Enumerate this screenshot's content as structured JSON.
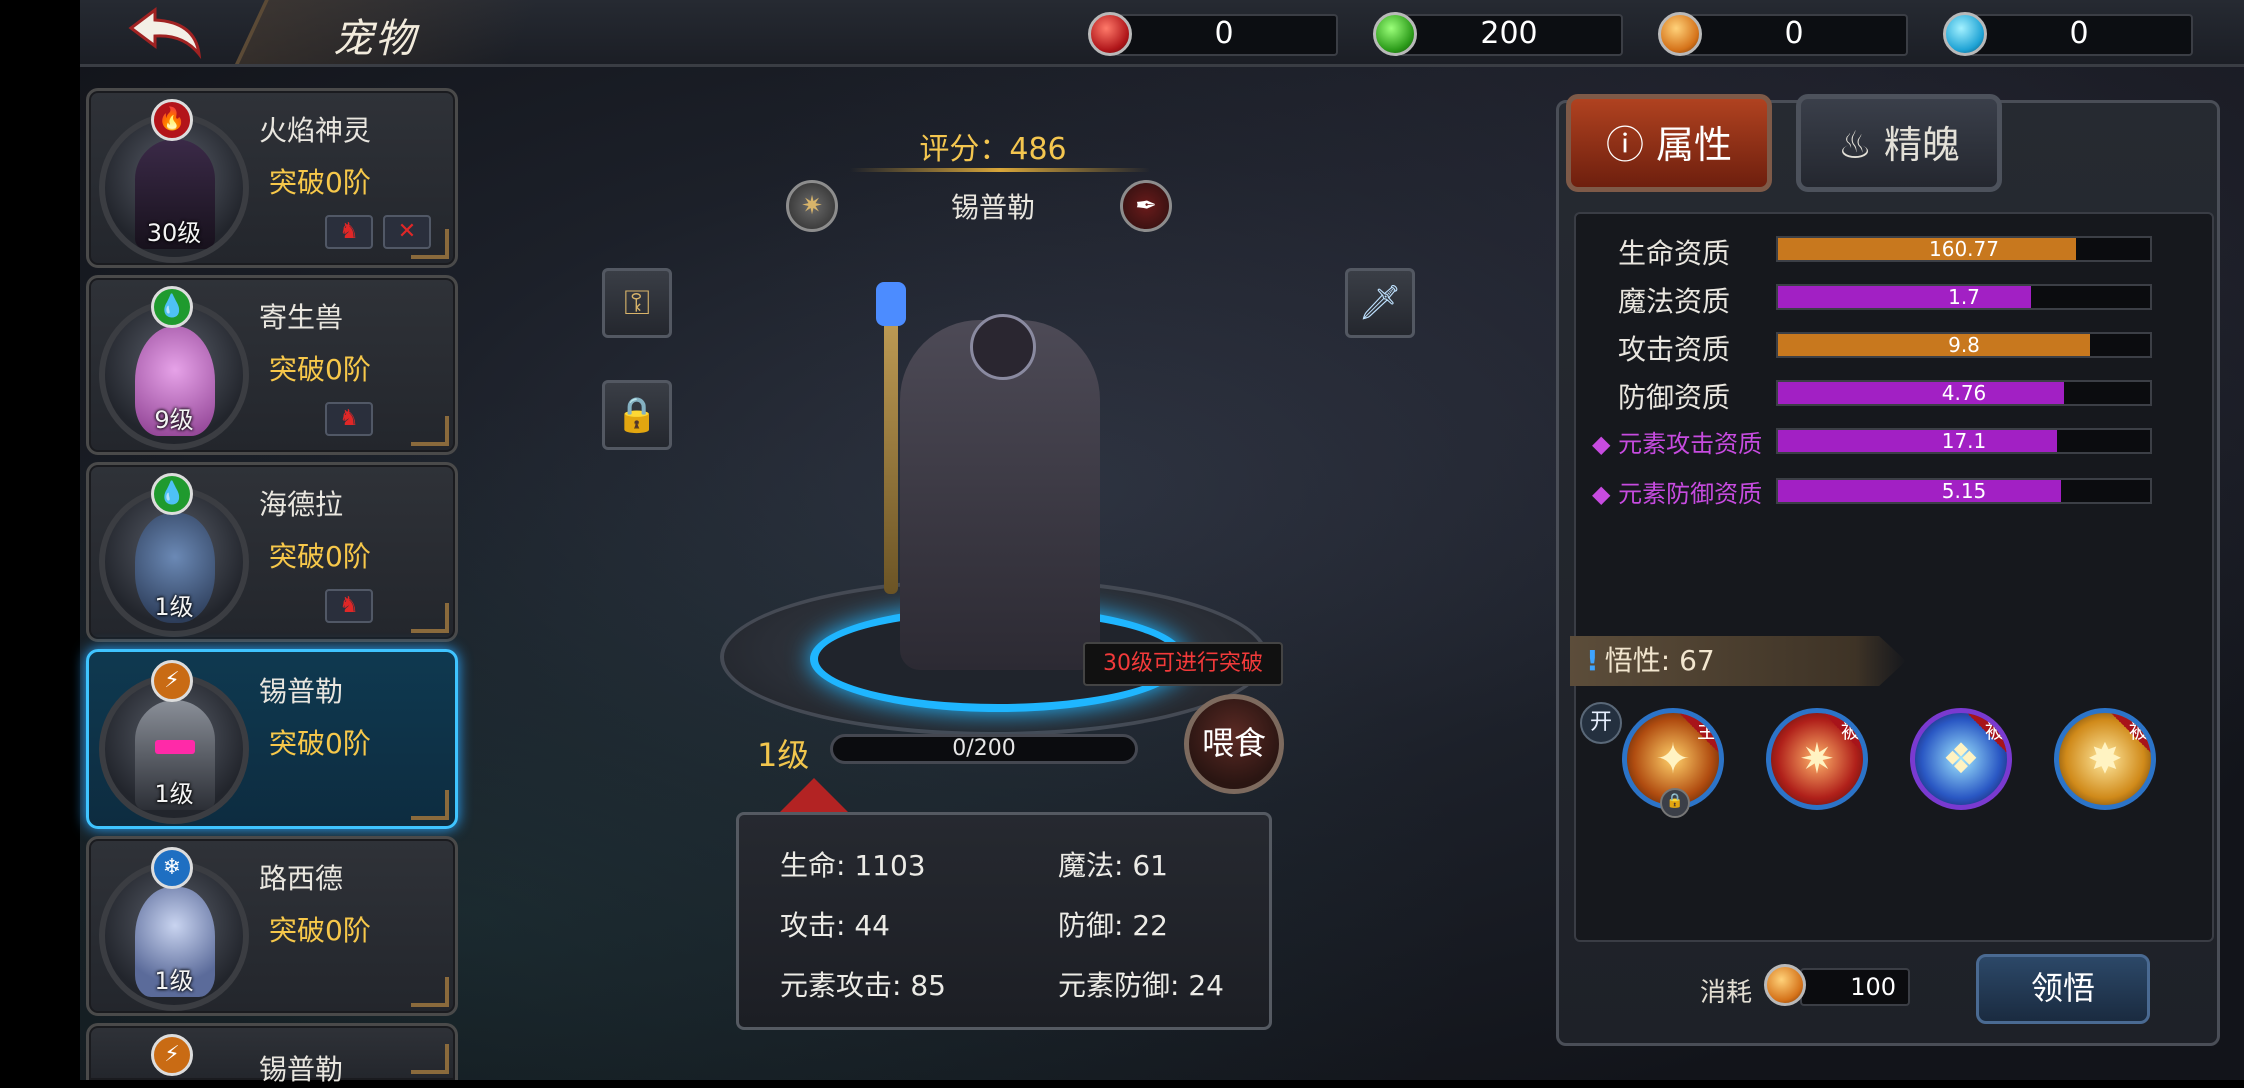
{
  "header": {
    "title": "宠物",
    "currencies": [
      {
        "icon": "red-gem-icon",
        "value": "0"
      },
      {
        "icon": "green-gem-icon",
        "value": "200"
      },
      {
        "icon": "orange-thunder-icon",
        "value": "0"
      },
      {
        "icon": "blue-ice-icon",
        "value": "0"
      }
    ]
  },
  "pets": [
    {
      "name": "火焰神灵",
      "breakthrough": "突破0阶",
      "level": "30级",
      "element": "fire",
      "element_glyph": "🔥"
    },
    {
      "name": "寄生兽",
      "breakthrough": "突破0阶",
      "level": "9级",
      "element": "water",
      "element_glyph": "💧"
    },
    {
      "name": "海德拉",
      "breakthrough": "突破0阶",
      "level": "1级",
      "element": "water",
      "element_glyph": "💧"
    },
    {
      "name": "锡普勒",
      "breakthrough": "突破0阶",
      "level": "1级",
      "element": "thunder",
      "element_glyph": "⚡",
      "selected": true
    },
    {
      "name": "路西德",
      "breakthrough": "突破0阶",
      "level": "1级",
      "element": "ice",
      "element_glyph": "❄"
    },
    {
      "name": "锡普勒",
      "breakthrough": "",
      "level": "",
      "element": "thunder",
      "element_glyph": "⚡"
    }
  ],
  "detail": {
    "score": "评分：486",
    "name": "锡普勒",
    "tooltip": "30级可进行突破",
    "feed": "喂食",
    "level": "1级",
    "exp": "0/200",
    "stats": {
      "hp": "生命: 1103",
      "mp": "魔法: 61",
      "atk": "攻击: 44",
      "def": "防御: 22",
      "elem_atk": "元素攻击: 85",
      "elem_def": "元素防御: 24"
    }
  },
  "tabs": {
    "attributes": "属性",
    "essence": "精魄"
  },
  "aptitudes": [
    {
      "label": "生命资质",
      "value": "160.77",
      "fill": 0.8,
      "color": "#c8781e",
      "special": false
    },
    {
      "label": "魔法资质",
      "value": "1.7",
      "fill": 0.68,
      "color": "#a220c4",
      "special": false
    },
    {
      "label": "攻击资质",
      "value": "9.8",
      "fill": 0.84,
      "color": "#c8781e",
      "special": false
    },
    {
      "label": "防御资质",
      "value": "4.76",
      "fill": 0.77,
      "color": "#a220c4",
      "special": false
    },
    {
      "label": "元素攻击资质",
      "value": "17.1",
      "fill": 0.75,
      "color": "#a220c4",
      "special": true
    },
    {
      "label": "元素防御资质",
      "value": "5.15",
      "fill": 0.76,
      "color": "#a220c4",
      "special": true
    }
  ],
  "wisdom": "悟性: 67",
  "open_badge": "开",
  "skills": [
    {
      "icon": "flame-strike-icon",
      "tag": "主",
      "glyph": "✦"
    },
    {
      "icon": "crimson-slash-icon",
      "tag": "被",
      "glyph": "✷"
    },
    {
      "icon": "ice-crystal-icon",
      "tag": "被",
      "glyph": "❖"
    },
    {
      "icon": "golden-blades-icon",
      "tag": "被",
      "glyph": "✸"
    }
  ],
  "cost": {
    "label": "消耗",
    "value": "100"
  },
  "comprehend": "领悟"
}
